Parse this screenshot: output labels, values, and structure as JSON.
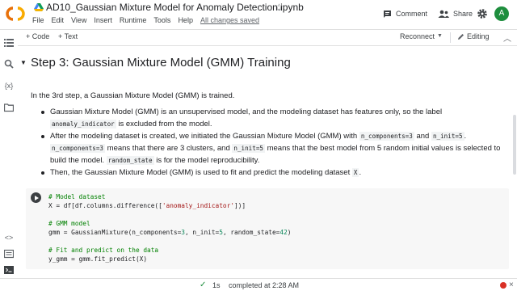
{
  "header": {
    "title": "AD10_Gaussian Mixture Model for Anomaly Detection.ipynb",
    "menus": [
      "File",
      "Edit",
      "View",
      "Insert",
      "Runtime",
      "Tools",
      "Help"
    ],
    "saved_status": "All changes saved",
    "comment_label": "Comment",
    "share_label": "Share",
    "avatar_letter": "A"
  },
  "toolbar": {
    "add_code": "+ Code",
    "add_text": "+ Text",
    "reconnect": "Reconnect",
    "editing": "Editing"
  },
  "section": {
    "title": "Step 3: Gaussian Mixture Model (GMM) Training",
    "intro": "In the 3rd step, a Gaussian Mixture Model (GMM) is trained.",
    "bullets": [
      {
        "text_a": "Gaussian Mixture Model (GMM) is an unsupervised model, and the modeling dataset has features only, so the label ",
        "code_a": "anomaly_indicator",
        "text_b": " is excluded from the model."
      },
      {
        "text_a": "After the modeling dataset is created, we initiated the Gaussian Mixture Model (GMM) with ",
        "code_a": "n_components=3",
        "text_b": " and ",
        "code_b": "n_init=5",
        "text_c": ". ",
        "code_c": "n_components=3",
        "text_d": " means that there are 3 clusters, and ",
        "code_d": "n_init=5",
        "text_e": " means that the best model from 5 random initial values is selected to build the model. ",
        "code_e": "random_state",
        "text_f": " is for the model reproducibility."
      },
      {
        "text_a": "Then, the Gaussian Mixture Model (GMM) is used to fit and predict the modeling dataset ",
        "code_a": "X",
        "text_b": "."
      }
    ]
  },
  "code_cell": {
    "comment1": "# Model dataset",
    "line1_a": "X = df[df.columns.difference([",
    "line1_str": "'anomaly_indicator'",
    "line1_b": "])]",
    "comment2": "# GMM model",
    "line2_a": "gmm = GaussianMixture(n_components=",
    "line2_n1": "3",
    "line2_b": ", n_init=",
    "line2_n2": "5",
    "line2_c": ", random_state=",
    "line2_n3": "42",
    "line2_d": ")",
    "comment3": "# Fit and predict on the data",
    "line3": "y_gmm = gmm.fit_predict(X)"
  },
  "status": {
    "check": "✓",
    "duration": "1s",
    "message": "completed at 2:28 AM"
  },
  "colors": {
    "accent_orange": "#f9ab00",
    "status_ok": "#1e8e3e",
    "status_error": "#d93025",
    "avatar_bg": "#1e8e3e"
  }
}
